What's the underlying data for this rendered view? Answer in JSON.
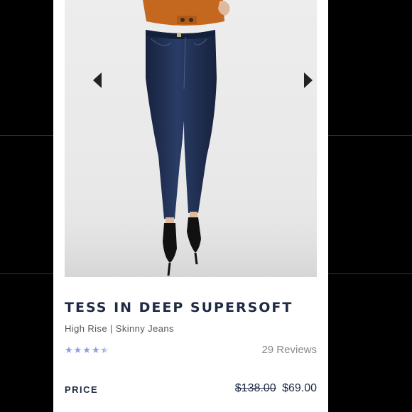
{
  "product": {
    "title": "TESS IN DEEP SUPERSOFT",
    "subtitle": "High Rise | Skinny Jeans",
    "rating": 4.5,
    "rating_max": 5,
    "reviews_label": "29 Reviews",
    "price_label": "PRICE",
    "original_price": "$138.00",
    "sale_price": "$69.00"
  },
  "gallery": {
    "image": "model-wearing-dark-wash-skinny-jeans",
    "prev_icon": "caret-left-icon",
    "next_icon": "caret-right-icon"
  },
  "colors": {
    "title": "#1f2a44",
    "star": "#8a9ee0",
    "denim": "#1e2f52",
    "top": "#c4681f"
  }
}
